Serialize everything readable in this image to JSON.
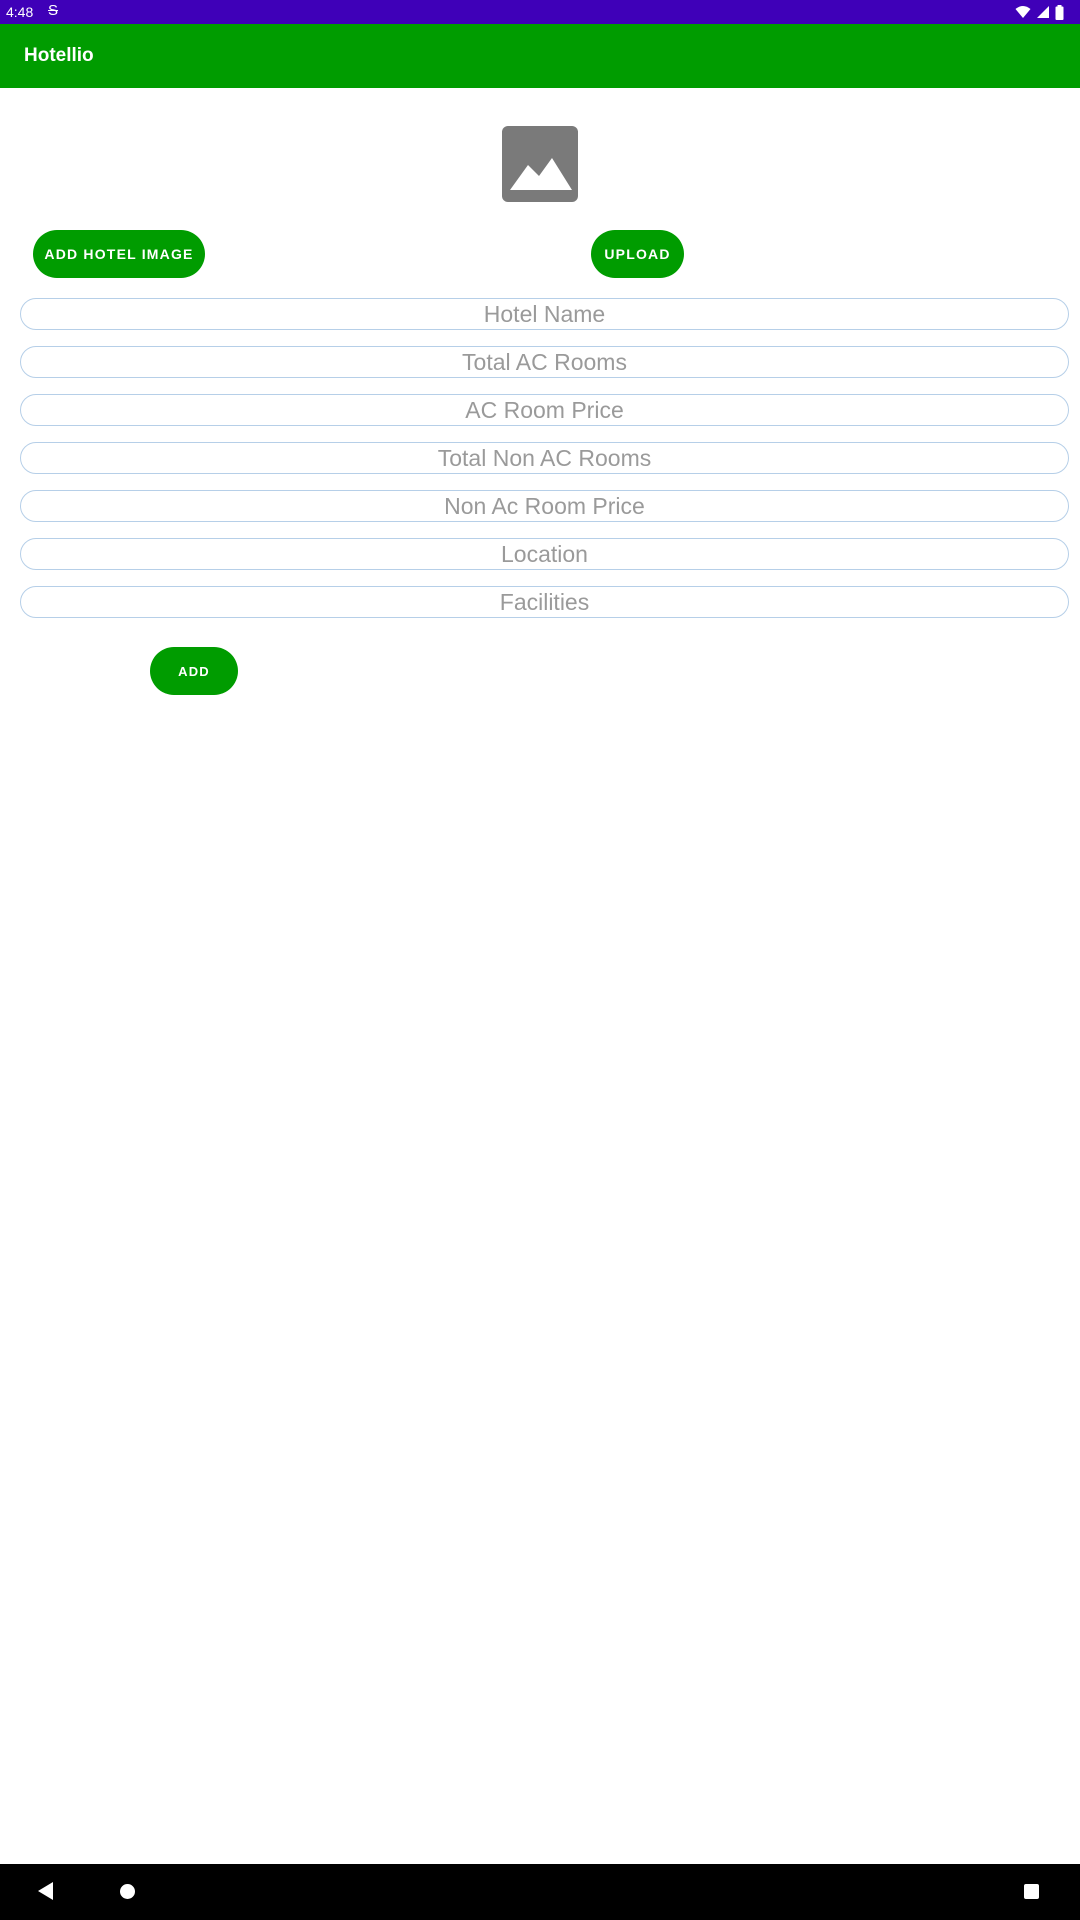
{
  "status_bar": {
    "time": "4:48",
    "background": "#3f00b8"
  },
  "app_bar": {
    "title": "Hotellio",
    "background": "#009c00"
  },
  "image_placeholder": {
    "icon": "image-icon"
  },
  "buttons": {
    "add_image": "ADD HOTEL IMAGE",
    "upload": "UPLOAD",
    "add": "ADD",
    "color": "#009c00"
  },
  "fields": {
    "hotel_name": {
      "placeholder": "Hotel Name",
      "value": ""
    },
    "total_ac_rooms": {
      "placeholder": "Total AC Rooms",
      "value": ""
    },
    "ac_room_price": {
      "placeholder": "AC Room Price",
      "value": ""
    },
    "total_non_ac_rooms": {
      "placeholder": "Total Non AC Rooms",
      "value": ""
    },
    "non_ac_room_price": {
      "placeholder": "Non Ac Room Price",
      "value": ""
    },
    "location": {
      "placeholder": "Location",
      "value": ""
    },
    "facilities": {
      "placeholder": "Facilities",
      "value": ""
    }
  },
  "nav_bar": {
    "icons": [
      "back-icon",
      "home-icon",
      "recents-icon"
    ]
  }
}
